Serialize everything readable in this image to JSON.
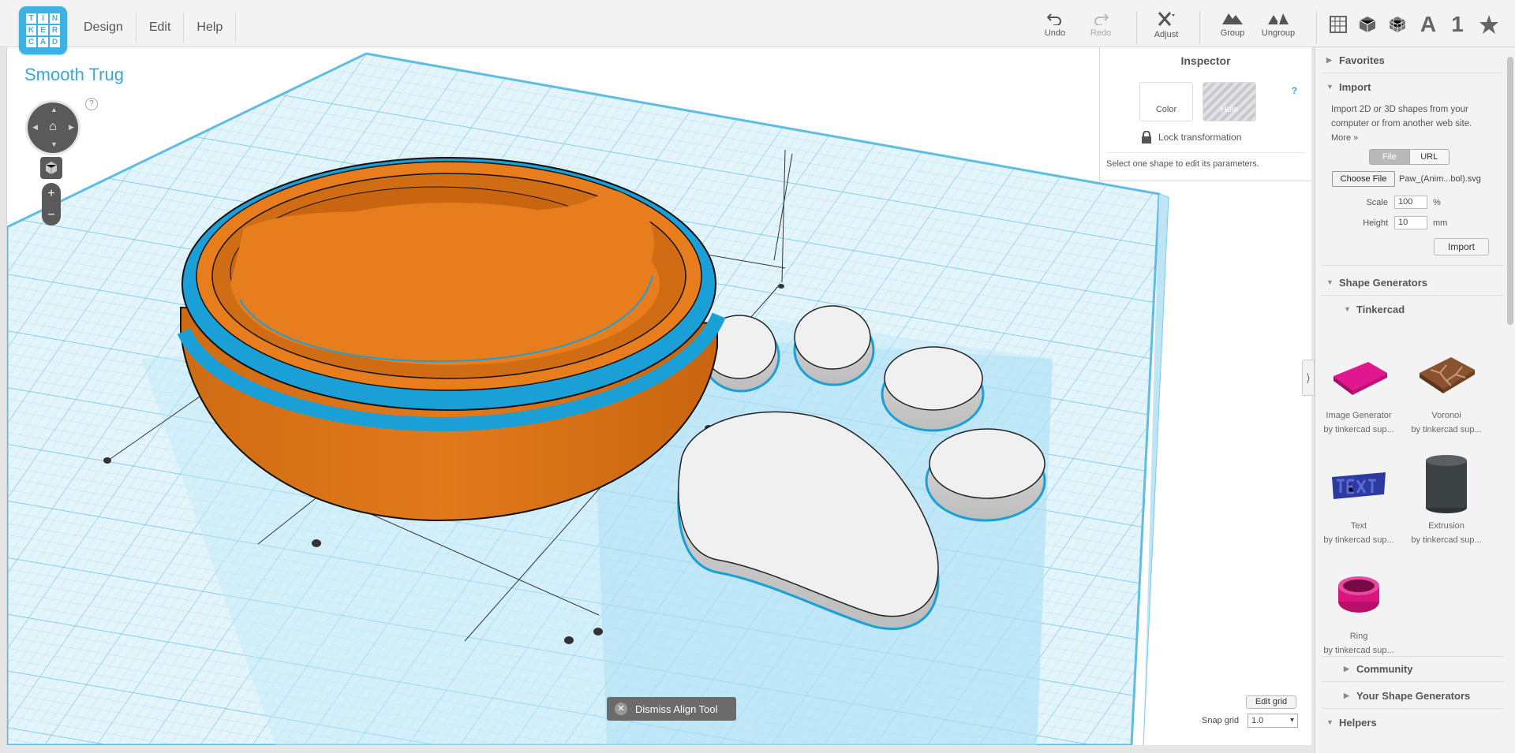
{
  "app": {
    "logo_letters": [
      "T",
      "I",
      "N",
      "K",
      "E",
      "R",
      "C",
      "A",
      "D"
    ],
    "menu": [
      {
        "id": "design",
        "label": "Design"
      },
      {
        "id": "edit",
        "label": "Edit"
      },
      {
        "id": "help",
        "label": "Help"
      }
    ]
  },
  "toolbar": {
    "undo": "Undo",
    "redo": "Redo",
    "adjust": "Adjust",
    "group": "Group",
    "ungroup": "Ungroup",
    "view_icons": [
      "grid-view-icon",
      "box-icon",
      "wire-box-icon",
      "text-a-icon",
      "number-one-icon",
      "star-icon"
    ],
    "text_a": "A",
    "number_one": "1"
  },
  "design": {
    "title": "Smooth Trug",
    "help": "?"
  },
  "inspector": {
    "title": "Inspector",
    "help": "?",
    "color_label": "Color",
    "hole_label": "Hole",
    "lock_label": "Lock transformation",
    "hint": "Select one shape to edit its parameters."
  },
  "workplane": {
    "dismiss_label": "Dismiss Align Tool",
    "edit_grid": "Edit grid",
    "snap_label": "Snap grid",
    "snap_value": "1.0",
    "colors": {
      "bowl": "#e87d1e",
      "rim": "#1a9fd6",
      "paw": "#f1f1f1",
      "grid_line": "#8fd0ec",
      "plane": "#daf0fa"
    }
  },
  "sidebar": {
    "favorites": "Favorites",
    "import": {
      "title": "Import",
      "description": "Import 2D or 3D shapes from your computer or from another web site.",
      "more": "More »",
      "tab_file": "File",
      "tab_url": "URL",
      "choose_file": "Choose File",
      "file_name": "Paw_(Anim...bol).svg",
      "scale_label": "Scale",
      "scale_value": "100",
      "scale_unit": "%",
      "height_label": "Height",
      "height_value": "10",
      "height_unit": "mm",
      "button": "Import"
    },
    "shape_generators": "Shape Generators",
    "tinkercad": "Tinkercad",
    "shapes": [
      {
        "name": "Image Generator",
        "by": "by tinkercad sup..."
      },
      {
        "name": "Voronoi",
        "by": "by tinkercad sup..."
      },
      {
        "name": "Text",
        "by": "by tinkercad sup..."
      },
      {
        "name": "Extrusion",
        "by": "by tinkercad sup..."
      },
      {
        "name": "Ring",
        "by": "by tinkercad sup..."
      }
    ],
    "community": "Community",
    "your_shape_generators": "Your Shape Generators",
    "helpers": "Helpers"
  }
}
